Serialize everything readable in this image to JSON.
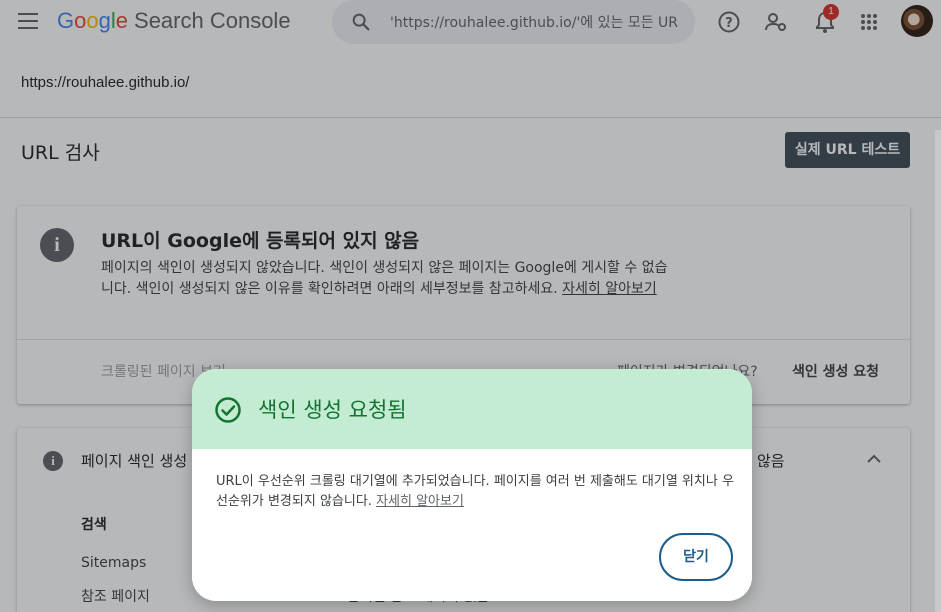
{
  "header": {
    "logo_letters": [
      "G",
      "o",
      "o",
      "g",
      "l",
      "e"
    ],
    "product_name": "Search Console",
    "search_value": "'https://rouhalee.github.io/'에 있는 모든 URL 검사",
    "notification_count": "1"
  },
  "property": {
    "url": "https://rouhalee.github.io/"
  },
  "page": {
    "title": "URL 검사",
    "test_live_url_label": "실제 URL 테스트"
  },
  "status_card": {
    "title": "URL이 Google에 등록되어 있지 않음",
    "description": "페이지의 색인이 생성되지 않았습니다. 색인이 생성되지 않은 페이지는 Google에 게시할 수 없습니다. 색인이 생성되지 않은 이유를 확인하려면 아래의 세부정보를 참고하세요. ",
    "learn_more": "자세히 알아보기",
    "view_crawled_label": "크롤링된 페이지 보기",
    "page_changed_question": "페이지가 변경되었나요?",
    "request_indexing_label": "색인 생성 요청"
  },
  "indexing_card": {
    "title": "페이지 색인 생성",
    "status": "않음",
    "rows": [
      {
        "label": "검색",
        "value": ""
      },
      {
        "label": "Sitemaps",
        "value": ""
      },
      {
        "label": "참조 페이지",
        "value": "감지된 참조 페이지 없음"
      }
    ]
  },
  "dialog": {
    "title": "색인 생성 요청됨",
    "body": "URL이 우선순위 크롤링 대기열에 추가되었습니다. 페이지를 여러 번 제출해도 대기열 위치나 우선순위가 변경되지 않습니다. ",
    "learn_more": "자세히 알아보기",
    "close_label": "닫기"
  },
  "colors": {
    "dialog_header_bg": "#c4ecd2",
    "dialog_title": "#137333",
    "close_button": "#1a5c8a",
    "test_button_bg": "#3c4a56"
  }
}
